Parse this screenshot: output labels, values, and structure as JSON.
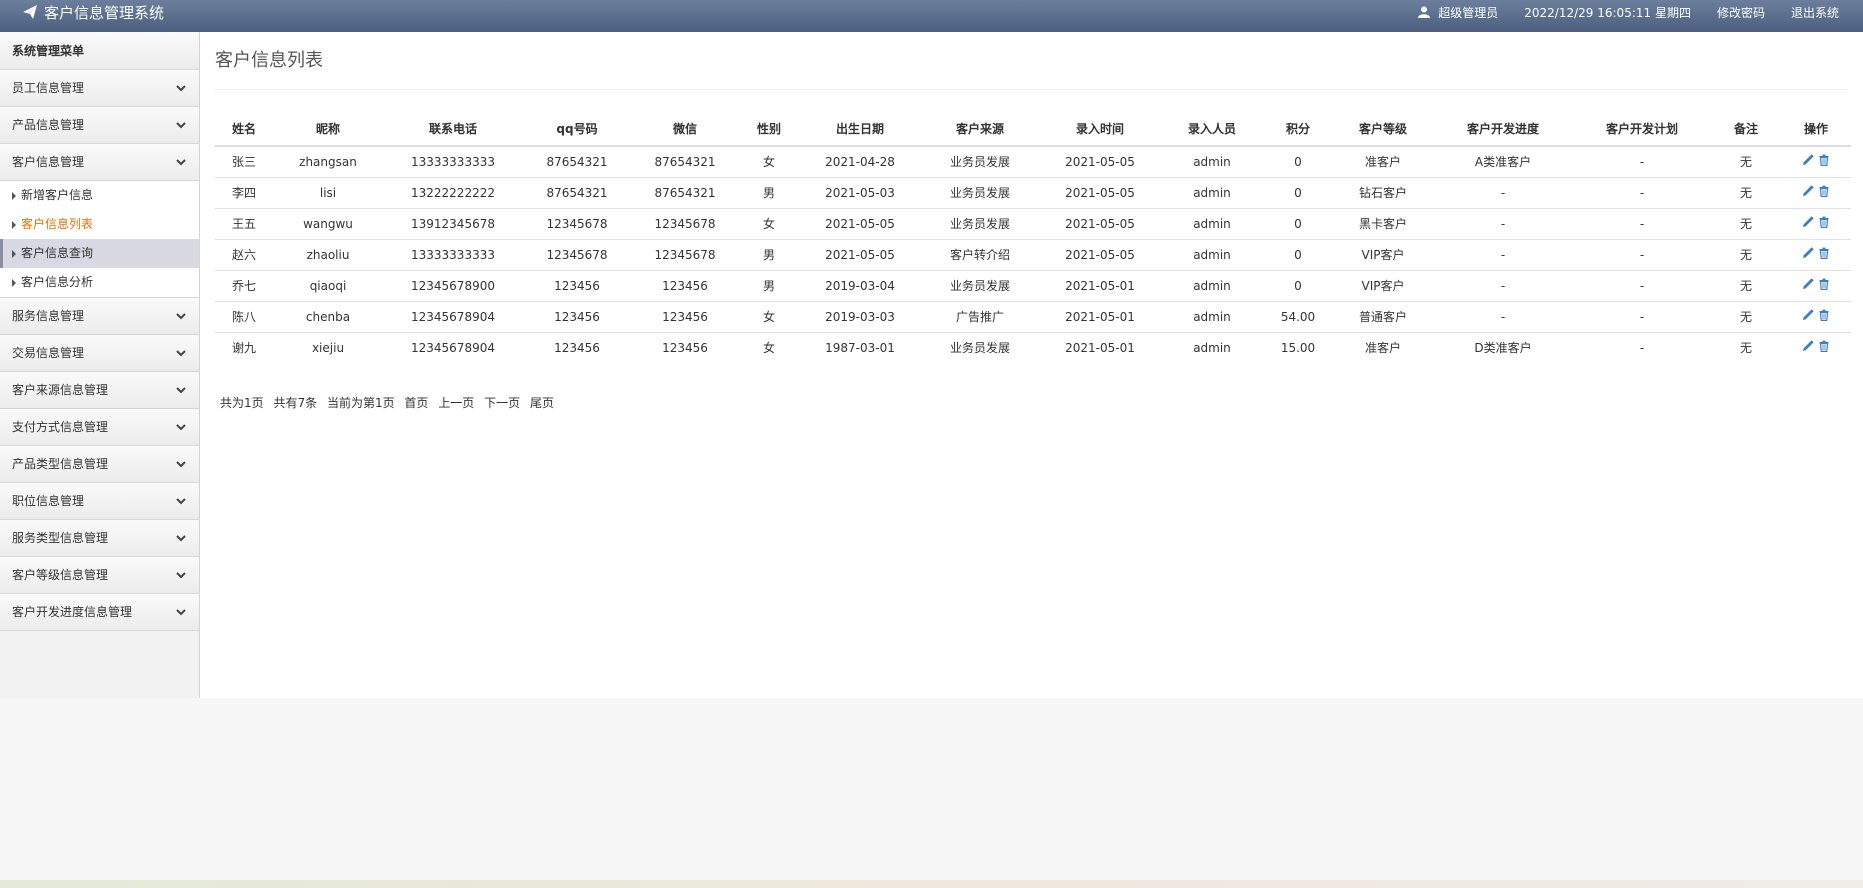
{
  "app": {
    "title": "客户信息管理系统",
    "user": "超级管理员",
    "datetime": "2022/12/29 16:05:11 星期四",
    "change_password": "修改密码",
    "logout": "退出系统"
  },
  "sidebar": {
    "title": "系统管理菜单",
    "groups": [
      {
        "label": "员工信息管理"
      },
      {
        "label": "产品信息管理"
      },
      {
        "label": "客户信息管理"
      },
      {
        "label": "服务信息管理"
      },
      {
        "label": "交易信息管理"
      },
      {
        "label": "客户来源信息管理"
      },
      {
        "label": "支付方式信息管理"
      },
      {
        "label": "产品类型信息管理"
      },
      {
        "label": "职位信息管理"
      },
      {
        "label": "服务类型信息管理"
      },
      {
        "label": "客户等级信息管理"
      },
      {
        "label": "客户开发进度信息管理"
      }
    ],
    "sub_items": [
      {
        "label": "新增客户信息"
      },
      {
        "label": "客户信息列表"
      },
      {
        "label": "客户信息查询"
      },
      {
        "label": "客户信息分析"
      }
    ]
  },
  "main": {
    "title": "客户信息列表",
    "columns": [
      "姓名",
      "昵称",
      "联系电话",
      "qq号码",
      "微信",
      "性别",
      "出生日期",
      "客户来源",
      "录入时间",
      "录入人员",
      "积分",
      "客户等级",
      "客户开发进度",
      "客户开发计划",
      "备注",
      "操作"
    ],
    "rows": [
      [
        "张三",
        "zhangsan",
        "13333333333",
        "87654321",
        "87654321",
        "女",
        "2021-04-28",
        "业务员发展",
        "2021-05-05",
        "admin",
        "0",
        "准客户",
        "A类准客户",
        "-",
        "无"
      ],
      [
        "李四",
        "lisi",
        "13222222222",
        "87654321",
        "87654321",
        "男",
        "2021-05-03",
        "业务员发展",
        "2021-05-05",
        "admin",
        "0",
        "钻石客户",
        "-",
        "-",
        "无"
      ],
      [
        "王五",
        "wangwu",
        "13912345678",
        "12345678",
        "12345678",
        "女",
        "2021-05-05",
        "业务员发展",
        "2021-05-05",
        "admin",
        "0",
        "黑卡客户",
        "-",
        "-",
        "无"
      ],
      [
        "赵六",
        "zhaoliu",
        "13333333333",
        "12345678",
        "12345678",
        "男",
        "2021-05-05",
        "客户转介绍",
        "2021-05-05",
        "admin",
        "0",
        "VIP客户",
        "-",
        "-",
        "无"
      ],
      [
        "乔七",
        "qiaoqi",
        "12345678900",
        "123456",
        "123456",
        "男",
        "2019-03-04",
        "业务员发展",
        "2021-05-01",
        "admin",
        "0",
        "VIP客户",
        "-",
        "-",
        "无"
      ],
      [
        "陈八",
        "chenba",
        "12345678904",
        "123456",
        "123456",
        "女",
        "2019-03-03",
        "广告推广",
        "2021-05-01",
        "admin",
        "54.00",
        "普通客户",
        "-",
        "-",
        "无"
      ],
      [
        "谢九",
        "xiejiu",
        "12345678904",
        "123456",
        "123456",
        "女",
        "1987-03-01",
        "业务员发展",
        "2021-05-01",
        "admin",
        "15.00",
        "准客户",
        "D类准客户",
        "-",
        "无"
      ]
    ]
  },
  "pager": {
    "total_pages": "共为1页",
    "total_records": "共有7条",
    "current_page": "当前为第1页",
    "first": "首页",
    "prev": "上一页",
    "next": "下一页",
    "last": "尾页"
  },
  "colors": {
    "header": "#56688a",
    "active_link": "#e8710a",
    "icon_blue": "#3a7fc4"
  },
  "icons": {
    "edit": "pencil-icon",
    "delete": "trash-icon",
    "brand": "paper-plane-icon",
    "user": "user-icon",
    "expand": "chevron-down-icon"
  }
}
